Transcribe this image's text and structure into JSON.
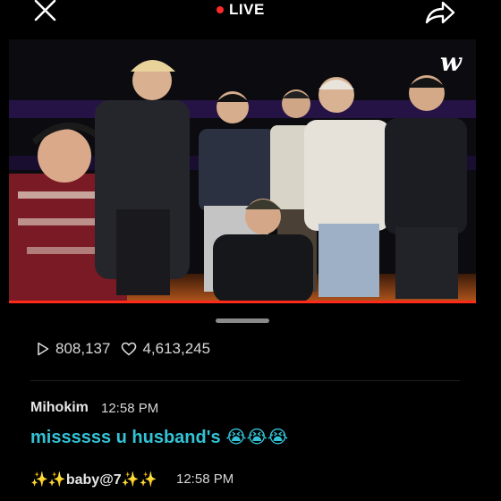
{
  "header": {
    "live_label": "LIVE",
    "live_color": "#ff2a2a"
  },
  "video": {
    "logo_text": "w",
    "progress_color": "#ff2a1a"
  },
  "stats": {
    "views": "808,137",
    "likes": "4,613,245"
  },
  "comments": [
    {
      "user": "Mihokim",
      "time": "12:58 PM",
      "text": "missssss u husband's",
      "emoji": "😭😭😭",
      "text_color": "#33c3d6"
    },
    {
      "user": "✨✨baby@7✨✨",
      "time": "12:58 PM"
    }
  ],
  "icons": {
    "close": "close-icon",
    "share": "share-icon",
    "views": "play-icon",
    "likes": "heart-icon"
  }
}
